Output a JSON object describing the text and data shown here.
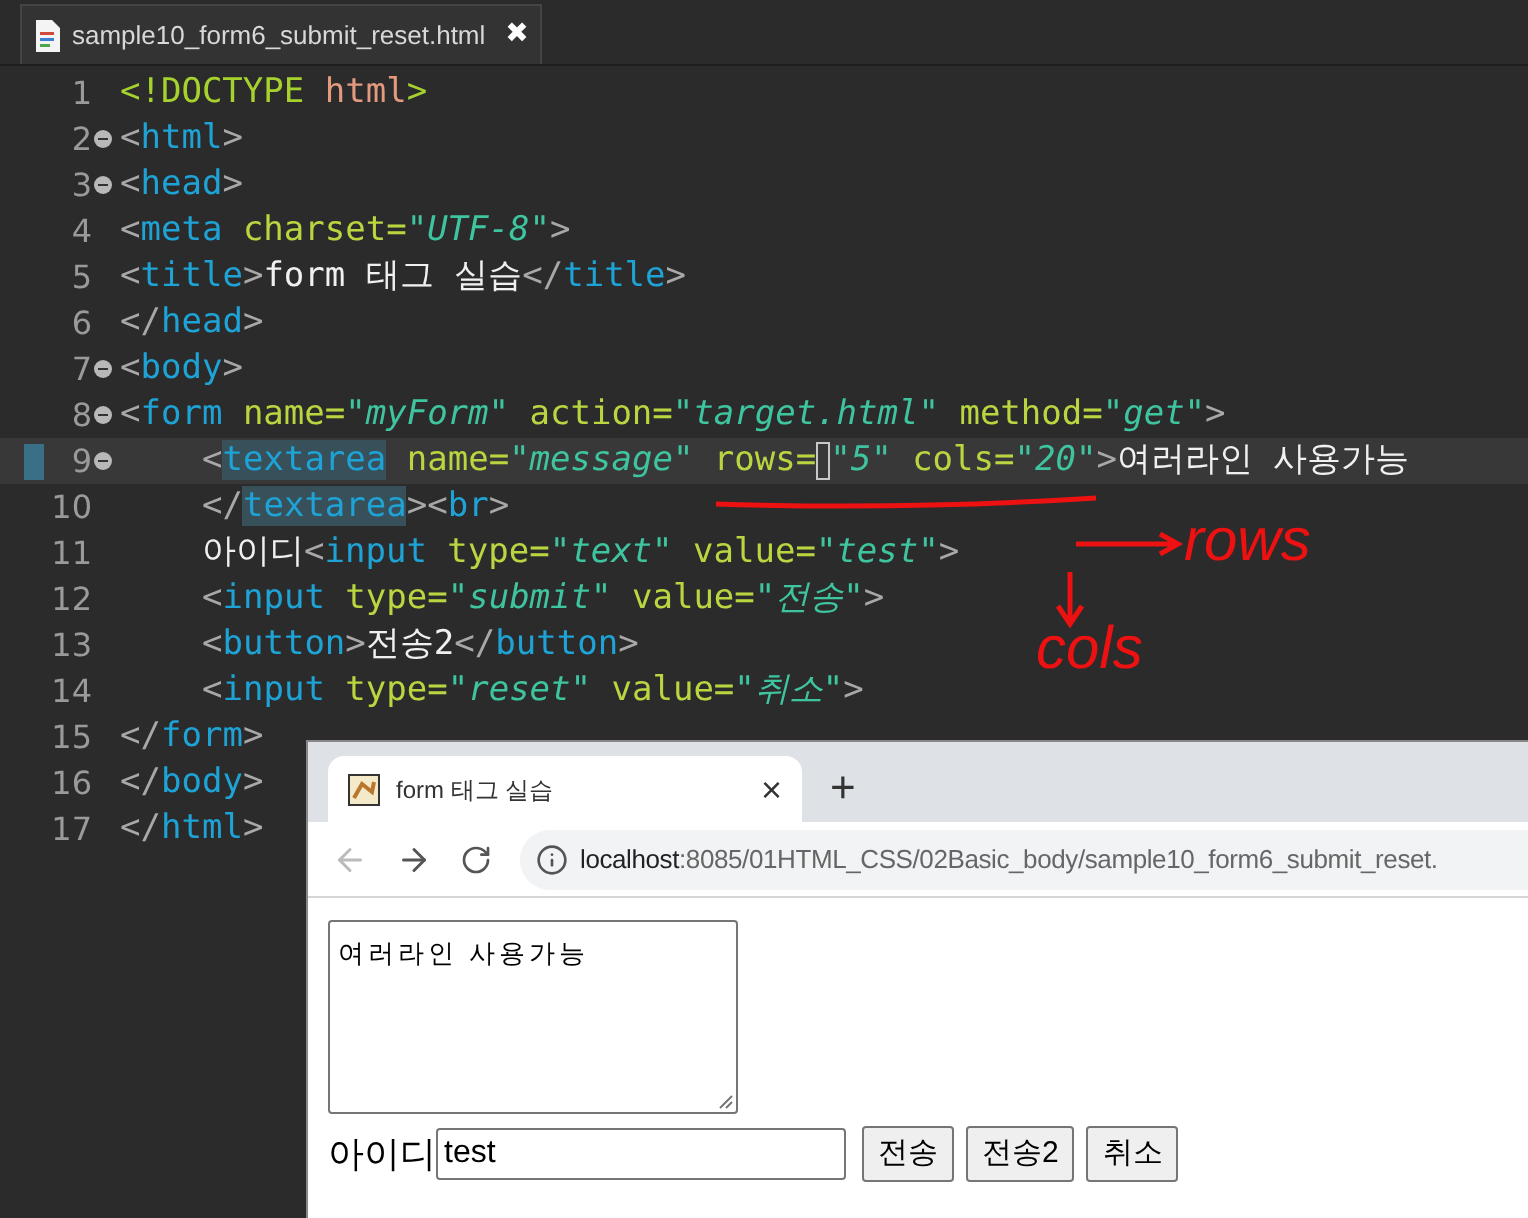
{
  "editor": {
    "tab": {
      "title": "sample10_form6_submit_reset.html",
      "close": "✖"
    },
    "lines": [
      {
        "number": "1",
        "fold": false,
        "current": false,
        "indented": false,
        "tokens": [
          {
            "kind": "doctype",
            "t": "<!DOCTYPE"
          },
          {
            "kind": "docname",
            "t": " html"
          },
          {
            "kind": "doctype",
            "t": ">"
          }
        ]
      },
      {
        "number": "2",
        "fold": true,
        "current": false,
        "indented": false,
        "tokens": [
          {
            "kind": "p",
            "t": "<"
          },
          {
            "kind": "tag",
            "t": "html"
          },
          {
            "kind": "p",
            "t": ">"
          }
        ]
      },
      {
        "number": "3",
        "fold": true,
        "current": false,
        "indented": false,
        "tokens": [
          {
            "kind": "p",
            "t": "<"
          },
          {
            "kind": "tag",
            "t": "head"
          },
          {
            "kind": "p",
            "t": ">"
          }
        ]
      },
      {
        "number": "4",
        "fold": false,
        "current": false,
        "indented": false,
        "tokens": [
          {
            "kind": "p",
            "t": "<"
          },
          {
            "kind": "tag",
            "t": "meta"
          },
          {
            "kind": "attr",
            "t": " charset="
          },
          {
            "kind": "value",
            "t": "\"UTF-8\""
          },
          {
            "kind": "p",
            "t": ">"
          }
        ]
      },
      {
        "number": "5",
        "fold": false,
        "current": false,
        "indented": false,
        "tokens": [
          {
            "kind": "p",
            "t": "<"
          },
          {
            "kind": "tag",
            "t": "title"
          },
          {
            "kind": "p",
            "t": ">"
          },
          {
            "kind": "text",
            "t": "form 태그 실습"
          },
          {
            "kind": "p",
            "t": "</"
          },
          {
            "kind": "tag",
            "t": "title"
          },
          {
            "kind": "p",
            "t": ">"
          }
        ]
      },
      {
        "number": "6",
        "fold": false,
        "current": false,
        "indented": false,
        "tokens": [
          {
            "kind": "p",
            "t": "</"
          },
          {
            "kind": "tag",
            "t": "head"
          },
          {
            "kind": "p",
            "t": ">"
          }
        ]
      },
      {
        "number": "7",
        "fold": true,
        "current": false,
        "indented": false,
        "tokens": [
          {
            "kind": "p",
            "t": "<"
          },
          {
            "kind": "tag",
            "t": "body"
          },
          {
            "kind": "p",
            "t": ">"
          }
        ]
      },
      {
        "number": "8",
        "fold": true,
        "current": false,
        "indented": false,
        "tokens": [
          {
            "kind": "p",
            "t": "<"
          },
          {
            "kind": "tag",
            "t": "form"
          },
          {
            "kind": "attr",
            "t": " name="
          },
          {
            "kind": "value",
            "t": "\"myForm\""
          },
          {
            "kind": "attr",
            "t": " action="
          },
          {
            "kind": "value",
            "t": "\"target.html\""
          },
          {
            "kind": "attr",
            "t": " method="
          },
          {
            "kind": "value",
            "t": "\"get\""
          },
          {
            "kind": "p",
            "t": ">"
          }
        ]
      },
      {
        "number": "9",
        "fold": true,
        "current": true,
        "indented": true,
        "tokens": [
          {
            "kind": "p",
            "t": "<"
          },
          {
            "kind": "occurrence",
            "t": "textarea"
          },
          {
            "kind": "attr",
            "t": " name="
          },
          {
            "kind": "value",
            "t": "\"message\""
          },
          {
            "kind": "attr",
            "t": " rows="
          },
          {
            "kind": "caret"
          },
          {
            "kind": "value",
            "t": "\"5\""
          },
          {
            "kind": "attr",
            "t": " cols="
          },
          {
            "kind": "value",
            "t": "\"20\""
          },
          {
            "kind": "p",
            "t": ">"
          },
          {
            "kind": "text",
            "t": "여러라인 사용가능"
          }
        ]
      },
      {
        "number": "10",
        "fold": false,
        "current": false,
        "indented": true,
        "tokens": [
          {
            "kind": "p",
            "t": "</"
          },
          {
            "kind": "occurrence",
            "t": "textarea"
          },
          {
            "kind": "p",
            "t": ">"
          },
          {
            "kind": "p",
            "t": "<"
          },
          {
            "kind": "tag",
            "t": "br"
          },
          {
            "kind": "p",
            "t": ">"
          }
        ]
      },
      {
        "number": "11",
        "fold": false,
        "current": false,
        "indented": true,
        "tokens": [
          {
            "kind": "text",
            "t": "아이디"
          },
          {
            "kind": "p",
            "t": "<"
          },
          {
            "kind": "tag",
            "t": "input"
          },
          {
            "kind": "attr",
            "t": " type="
          },
          {
            "kind": "value",
            "t": "\"text\""
          },
          {
            "kind": "attr",
            "t": " value="
          },
          {
            "kind": "value",
            "t": "\"test\""
          },
          {
            "kind": "p",
            "t": ">"
          }
        ]
      },
      {
        "number": "12",
        "fold": false,
        "current": false,
        "indented": true,
        "tokens": [
          {
            "kind": "p",
            "t": "<"
          },
          {
            "kind": "tag",
            "t": "input"
          },
          {
            "kind": "attr",
            "t": " type="
          },
          {
            "kind": "value",
            "t": "\"submit\""
          },
          {
            "kind": "attr",
            "t": " value="
          },
          {
            "kind": "value",
            "t": "\"전송\""
          },
          {
            "kind": "p",
            "t": ">"
          }
        ]
      },
      {
        "number": "13",
        "fold": false,
        "current": false,
        "indented": true,
        "tokens": [
          {
            "kind": "p",
            "t": "<"
          },
          {
            "kind": "tag",
            "t": "button"
          },
          {
            "kind": "p",
            "t": ">"
          },
          {
            "kind": "text",
            "t": "전송2"
          },
          {
            "kind": "p",
            "t": "</"
          },
          {
            "kind": "tag",
            "t": "button"
          },
          {
            "kind": "p",
            "t": ">"
          }
        ]
      },
      {
        "number": "14",
        "fold": false,
        "current": false,
        "indented": true,
        "tokens": [
          {
            "kind": "p",
            "t": "<"
          },
          {
            "kind": "tag",
            "t": "input"
          },
          {
            "kind": "attr",
            "t": " type="
          },
          {
            "kind": "value",
            "t": "\"reset\""
          },
          {
            "kind": "attr",
            "t": " value="
          },
          {
            "kind": "value",
            "t": "\"취소\""
          },
          {
            "kind": "p",
            "t": ">"
          }
        ]
      },
      {
        "number": "15",
        "fold": false,
        "current": false,
        "indented": false,
        "tokens": [
          {
            "kind": "p",
            "t": "</"
          },
          {
            "kind": "tag",
            "t": "form"
          },
          {
            "kind": "p",
            "t": ">"
          }
        ]
      },
      {
        "number": "16",
        "fold": false,
        "current": false,
        "indented": false,
        "tokens": [
          {
            "kind": "p",
            "t": "</"
          },
          {
            "kind": "tag",
            "t": "body"
          },
          {
            "kind": "p",
            "t": ">"
          }
        ]
      },
      {
        "number": "17",
        "fold": false,
        "current": false,
        "indented": false,
        "tokens": [
          {
            "kind": "p",
            "t": "</"
          },
          {
            "kind": "tag",
            "t": "html"
          },
          {
            "kind": "p",
            "t": ">"
          }
        ]
      }
    ]
  },
  "annotations": {
    "rows": "rows",
    "cols": "cols"
  },
  "browser": {
    "tab": {
      "title": "form 태그 실습",
      "close": "×"
    },
    "new_tab": "+",
    "address": {
      "host": "localhost",
      "path": ":8085/01HTML_CSS/02Basic_body/sample10_form6_submit_reset."
    },
    "back_disabled": true,
    "page": {
      "textarea": "여러라인 사용가능",
      "label": "아이디",
      "input": "test",
      "buttons": [
        "전송",
        "전송2",
        "취소"
      ]
    }
  }
}
